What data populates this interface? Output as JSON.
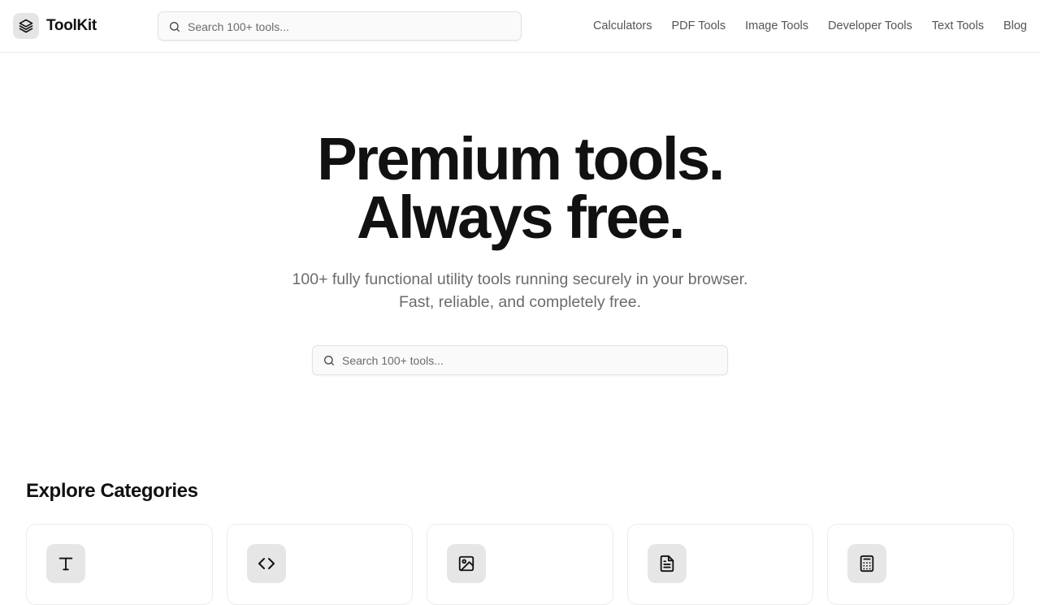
{
  "header": {
    "brand": "ToolKit",
    "logo_icon": "layers-icon",
    "search_placeholder": "Search 100+ tools...",
    "nav": [
      "Calculators",
      "PDF Tools",
      "Image Tools",
      "Developer Tools",
      "Text Tools",
      "Blog"
    ]
  },
  "hero": {
    "title_line1": "Premium tools.",
    "title_line2": "Always free.",
    "subtitle_line1": "100+ fully functional utility tools running securely in your browser.",
    "subtitle_line2": "Fast, reliable, and completely free.",
    "search_placeholder": "Search 100+ tools..."
  },
  "categories": {
    "title": "Explore Categories",
    "cards": [
      {
        "icon": "text-icon"
      },
      {
        "icon": "code-icon"
      },
      {
        "icon": "image-icon"
      },
      {
        "icon": "document-icon"
      },
      {
        "icon": "calculator-icon"
      }
    ]
  }
}
